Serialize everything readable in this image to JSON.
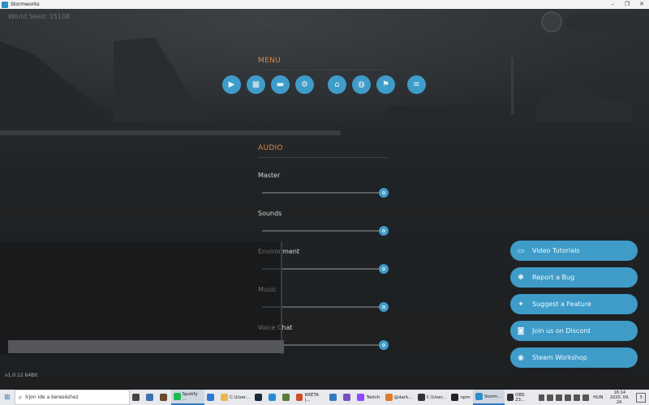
{
  "window": {
    "title": "Stormworks",
    "minimize": "–",
    "maximize": "❐",
    "close": "✕"
  },
  "world_seed": "World Seed: 15108",
  "top_right": {
    "text": ""
  },
  "menu": {
    "title": "MENU",
    "buttons": [
      {
        "name": "play-button",
        "icon": "play-icon",
        "glyph": "▶"
      },
      {
        "name": "calendar-button",
        "icon": "calendar-icon",
        "glyph": "▦"
      },
      {
        "name": "folder-button",
        "icon": "folder-icon",
        "glyph": "▬"
      },
      {
        "name": "settings-button",
        "icon": "gear-icon",
        "glyph": "⚙"
      },
      {
        "name": "shop-button",
        "icon": "store-icon",
        "glyph": "⌂"
      },
      {
        "name": "workshop-button",
        "icon": "globe-icon",
        "glyph": "◍"
      },
      {
        "name": "flag-button",
        "icon": "flag-icon",
        "glyph": "⚑"
      },
      {
        "name": "list-button",
        "icon": "list-icon",
        "glyph": "≡"
      }
    ]
  },
  "audio": {
    "title": "AUDIO",
    "sliders": [
      {
        "label": "Master",
        "value": 1.0
      },
      {
        "label": "Sounds",
        "value": 1.0
      },
      {
        "label": "Environment",
        "value": 1.0
      },
      {
        "label": "Music",
        "value": 1.0
      },
      {
        "label": "Voice Chat",
        "value": 1.0
      }
    ]
  },
  "help": [
    {
      "label": "Video Tutorials",
      "icon": "monitor-icon",
      "glyph": "▭"
    },
    {
      "label": "Report a Bug",
      "icon": "bug-icon",
      "glyph": "✱"
    },
    {
      "label": "Suggest a Feature",
      "icon": "lightbulb-icon",
      "glyph": "✦"
    },
    {
      "label": "Join us on Discord",
      "icon": "discord-icon",
      "glyph": "◙"
    },
    {
      "label": "Steam Workshop",
      "icon": "steam-icon",
      "glyph": "◉"
    }
  ],
  "version": "v1.0.12 64Bit",
  "taskbar": {
    "search_placeholder": "Írjon ide a kereséshez",
    "items": [
      {
        "label": "",
        "color": "#444"
      },
      {
        "label": "",
        "color": "#3d6fb0"
      },
      {
        "label": "",
        "color": "#6a4a2a"
      },
      {
        "label": "Spotify ...",
        "color": "#1db954",
        "active": true
      },
      {
        "label": "",
        "color": "#2c7bd1"
      },
      {
        "label": "C:\\User...",
        "color": "#e8b84a"
      },
      {
        "label": "",
        "color": "#1b2838"
      },
      {
        "label": "",
        "color": "#2b8ad1"
      },
      {
        "label": "",
        "color": "#5a7b3a"
      },
      {
        "label": "KRÉTA |...",
        "color": "#d04a2a"
      },
      {
        "label": "",
        "color": "#2f7cc4"
      },
      {
        "label": "",
        "color": "#7b4fc4"
      },
      {
        "label": "Twitch",
        "color": "#9146ff"
      },
      {
        "label": "@dark...",
        "color": "#e07a2a"
      },
      {
        "label": "C:\\User...",
        "color": "#333"
      },
      {
        "label": "npm",
        "color": "#222"
      },
      {
        "label": "Storm...",
        "color": "#2b8fc9",
        "active": true
      },
      {
        "label": "OBS 23...",
        "color": "#302e31"
      }
    ],
    "language": "HUN",
    "time": "16:14",
    "date": "2020. 09. 24.",
    "notification_count": "3"
  }
}
